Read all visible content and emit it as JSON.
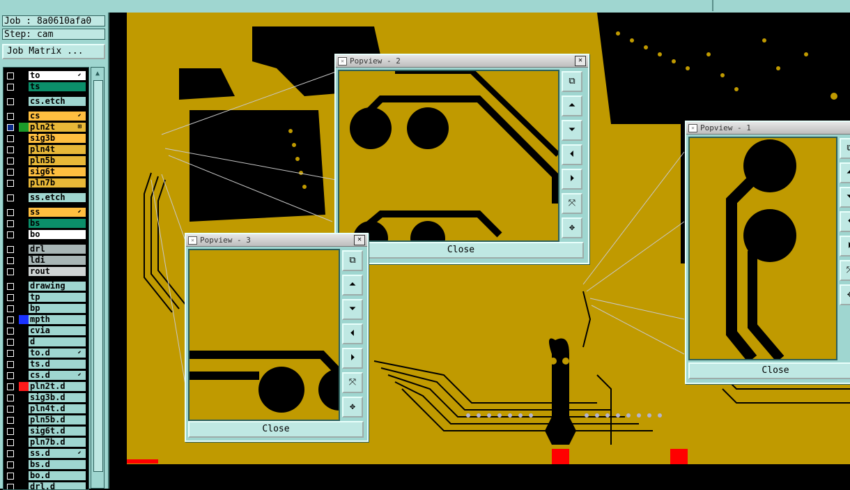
{
  "job": {
    "label": "Job : 8a0610afa0",
    "step": "Step: cam",
    "matrix_button": "Job Matrix ..."
  },
  "layers": [
    {
      "name": "to",
      "color": "#ffffff",
      "sel": "#000000",
      "mark": "⬋"
    },
    {
      "name": "ts",
      "color": "#0b8f6a",
      "sel": "#000000",
      "mark": ""
    },
    {
      "name": "cs.etch",
      "color": "#9fd6d0",
      "sel": "#000000",
      "mark": ""
    },
    {
      "name": "cs",
      "color": "#ffbf40",
      "sel": "#000000",
      "mark": "⬋"
    },
    {
      "name": "pln2t",
      "color": "#e8b838",
      "sel": "#0a2a8a",
      "sw": "#1a9a2a",
      "mark": "⊞"
    },
    {
      "name": "sig3b",
      "color": "#ffbf40",
      "sel": "#000000",
      "mark": ""
    },
    {
      "name": "pln4t",
      "color": "#e8b838",
      "sel": "#000000",
      "mark": ""
    },
    {
      "name": "pln5b",
      "color": "#e8b838",
      "sel": "#000000",
      "mark": ""
    },
    {
      "name": "sig6t",
      "color": "#ffbf40",
      "sel": "#000000",
      "mark": ""
    },
    {
      "name": "pln7b",
      "color": "#e8b838",
      "sel": "#000000",
      "mark": ""
    },
    {
      "name": "ss.etch",
      "color": "#9fd6d0",
      "sel": "#000000",
      "mark": ""
    },
    {
      "name": "ss",
      "color": "#ffbf40",
      "sel": "#000000",
      "mark": "⬋"
    },
    {
      "name": "bs",
      "color": "#0b8f6a",
      "sel": "#000000",
      "mark": ""
    },
    {
      "name": "bo",
      "color": "#ffffff",
      "sel": "#000000",
      "mark": ""
    },
    {
      "name": "drl",
      "color": "#a8b6b6",
      "sel": "#000000",
      "mark": ""
    },
    {
      "name": "ldi",
      "color": "#a8b6b6",
      "sel": "#000000",
      "mark": ""
    },
    {
      "name": "rout",
      "color": "#cfd4d4",
      "sel": "#000000",
      "mark": ""
    },
    {
      "name": "drawing",
      "color": "#9fd6d0",
      "sel": "#000000",
      "mark": ""
    },
    {
      "name": "tp",
      "color": "#9fd6d0",
      "sel": "#000000",
      "mark": ""
    },
    {
      "name": "bp",
      "color": "#9fd6d0",
      "sel": "#000000",
      "mark": ""
    },
    {
      "name": "mpth",
      "color": "#9fd6d0",
      "sel": "#000000",
      "sw": "#1a32ff",
      "mark": ""
    },
    {
      "name": "cvia",
      "color": "#9fd6d0",
      "sel": "#000000",
      "mark": ""
    },
    {
      "name": "d",
      "color": "#9fd6d0",
      "sel": "#000000",
      "mark": ""
    },
    {
      "name": "to.d",
      "color": "#9fd6d0",
      "sel": "#000000",
      "mark": "⬋"
    },
    {
      "name": "ts.d",
      "color": "#9fd6d0",
      "sel": "#000000",
      "mark": ""
    },
    {
      "name": "cs.d",
      "color": "#9fd6d0",
      "sel": "#000000",
      "mark": "⬋"
    },
    {
      "name": "pln2t.d",
      "color": "#9fd6d0",
      "sel": "#000000",
      "sw": "#ff1a1a",
      "mark": ""
    },
    {
      "name": "sig3b.d",
      "color": "#9fd6d0",
      "sel": "#000000",
      "mark": ""
    },
    {
      "name": "pln4t.d",
      "color": "#9fd6d0",
      "sel": "#000000",
      "mark": ""
    },
    {
      "name": "pln5b.d",
      "color": "#9fd6d0",
      "sel": "#000000",
      "mark": ""
    },
    {
      "name": "sig6t.d",
      "color": "#9fd6d0",
      "sel": "#000000",
      "mark": ""
    },
    {
      "name": "pln7b.d",
      "color": "#9fd6d0",
      "sel": "#000000",
      "mark": ""
    },
    {
      "name": "ss.d",
      "color": "#9fd6d0",
      "sel": "#000000",
      "mark": "⬋"
    },
    {
      "name": "bs.d",
      "color": "#9fd6d0",
      "sel": "#000000",
      "mark": ""
    },
    {
      "name": "bo.d",
      "color": "#9fd6d0",
      "sel": "#000000",
      "mark": ""
    },
    {
      "name": "drl.d",
      "color": "#9fd6d0",
      "sel": "#000000",
      "mark": ""
    }
  ],
  "popups": [
    {
      "title": "Popview - 2",
      "close": "Close"
    },
    {
      "title": "Popview - 1",
      "close": "Close"
    },
    {
      "title": "Popview - 3",
      "close": "Close"
    }
  ],
  "tool_icons": [
    "zoom-fit-icon",
    "pan-up-icon",
    "pan-down-icon",
    "pan-left-icon",
    "pan-right-icon",
    "zoom-out-icon",
    "zoom-in-icon"
  ],
  "colors": {
    "board": "#c09a00",
    "copper": "#000000",
    "panel": "#9fd6d0"
  }
}
